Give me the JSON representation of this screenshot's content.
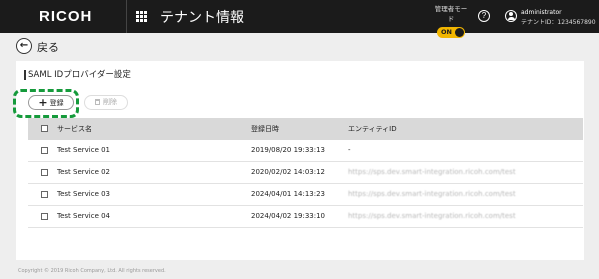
{
  "header": {
    "logo": "RICOH",
    "app_title": "テナント情報",
    "admin_mode_label": "管理者モード",
    "admin_mode_toggle": "ON",
    "help_symbol": "?",
    "user_name": "administrator",
    "tenant_id": "テナントID：1234567890",
    "icons": {
      "apps": "grid-icon",
      "help": "help-icon",
      "user": "user-icon"
    },
    "colors": {
      "header_bg": "#1b1b1b",
      "toggle_on": "#f2b600"
    }
  },
  "back": {
    "label": "戻る",
    "symbol": "←"
  },
  "section": {
    "title": "SAML IDプロバイダー設定",
    "register_label": "登録",
    "register_symbol": "+",
    "delete_label": "削除",
    "highlight_color": "#159a3b"
  },
  "table": {
    "columns": [
      "サービス名",
      "登録日時",
      "エンティティID"
    ],
    "rows": [
      {
        "name": "Test Service 01",
        "date": "2019/08/20 19:33:13",
        "entity": "-"
      },
      {
        "name": "Test Service 02",
        "date": "2020/02/02 14:03:12",
        "entity": "https://sps.dev.smart-integration.ricoh.com/test"
      },
      {
        "name": "Test Service 03",
        "date": "2024/04/01 14:13:23",
        "entity": "https://sps.dev.smart-integration.ricoh.com/test"
      },
      {
        "name": "Test Service 04",
        "date": "2024/04/02 19:33:10",
        "entity": "https://sps.dev.smart-integration.ricoh.com/test"
      }
    ]
  },
  "footer": {
    "copyright": "Copyright © 2019 Ricoh Company, Ltd. All rights reserved."
  }
}
